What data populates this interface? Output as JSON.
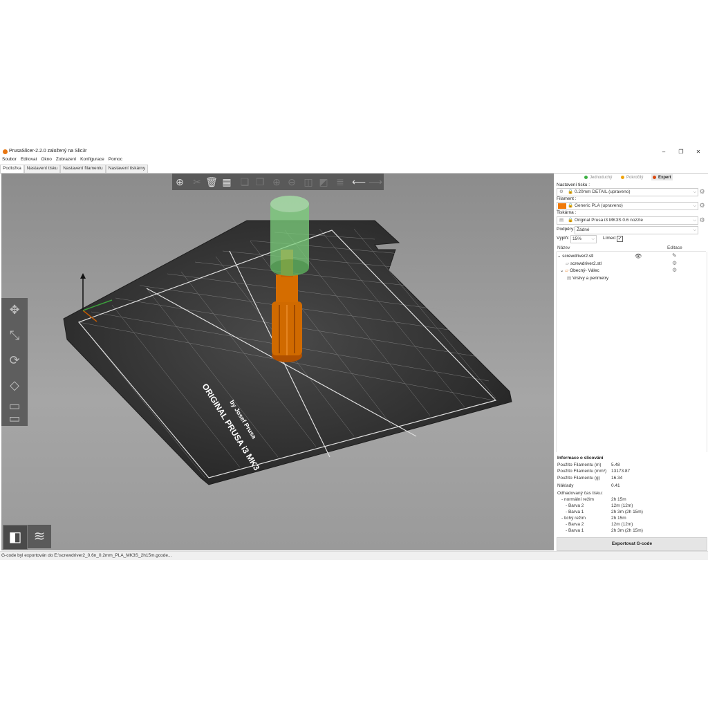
{
  "window": {
    "title": "PrusaSlicer-2.2.0 založený na Slic3r",
    "minimize_icon": "minimize-icon",
    "maximize_icon": "maximize-icon",
    "close_icon": "close-icon"
  },
  "menu": [
    "Soubor",
    "Editovat",
    "Okno",
    "Zobrazení",
    "Konfigurace",
    "Pomoc"
  ],
  "tabs": [
    "Podložka",
    "Nastavení tisku",
    "Nastavení filamentu",
    "Nastavení tiskárny"
  ],
  "bed": {
    "brand_line1": "ORIGINAL PRUSA i3 MK3",
    "brand_line2": "by Josef Prusa"
  },
  "modes": [
    {
      "label": "Jednoduchý",
      "color": "#3cb043"
    },
    {
      "label": "Pokročilý",
      "color": "#f0a30a"
    },
    {
      "label": "Expert",
      "color": "#d9480f"
    }
  ],
  "sidebar": {
    "print_settings_label": "Nastavení tisku :",
    "print_settings_value": "0.20mm DETAIL (upraveno)",
    "filament_label": "Filament :",
    "filament_value": "Generic PLA (upraveno)",
    "filament_color": "#f07a0a",
    "printer_label": "Tiskárna :",
    "printer_value": "Original Prusa i3 MK3S 0.6 nozzle",
    "supports_label": "Podpěry:",
    "supports_value": "Žádné",
    "infill_label": "Výplň:",
    "infill_value": "15%",
    "brim_label": "Límec:",
    "brim_checked": true
  },
  "object_list": {
    "col_name": "Název",
    "col_edit": "Editace",
    "items": [
      {
        "name": "screwdriver2.stl",
        "level": 0
      },
      {
        "name": "screwdriver2.stl",
        "level": 1
      },
      {
        "name": "Obecný- Válec",
        "level": 1
      },
      {
        "name": "Vrstvy a perimetry",
        "level": 2
      }
    ]
  },
  "slice_info": {
    "title": "Informace o slicování",
    "rows": [
      {
        "label": "Použito Filamentu (m)",
        "value": "5.48"
      },
      {
        "label": "Použito Filamentu (mm³)",
        "value": "13173.87"
      },
      {
        "label": "Použito Filamentu (g)",
        "value": "16.34"
      },
      {
        "label": "Náklady",
        "value": "0.41"
      },
      {
        "label": "Odhadovaný čas tisku:",
        "value": ""
      },
      {
        "label": "- normální režim",
        "value": "2h 15m"
      },
      {
        "label": "- Barva 2",
        "value": "12m (12m)"
      },
      {
        "label": "- Barva 1",
        "value": "2h 3m (2h 15m)"
      },
      {
        "label": "- tichý režim",
        "value": "2h 15m"
      },
      {
        "label": "- Barva 2",
        "value": "12m (12m)"
      },
      {
        "label": "- Barva 1",
        "value": "2h 3m (2h 15m)"
      }
    ]
  },
  "export_button": "Exportovat G-code",
  "status": "G-code byl exportován do E:\\screwdriver2_0.6n_0.2mm_PLA_MK3S_2h15m.gcode..."
}
